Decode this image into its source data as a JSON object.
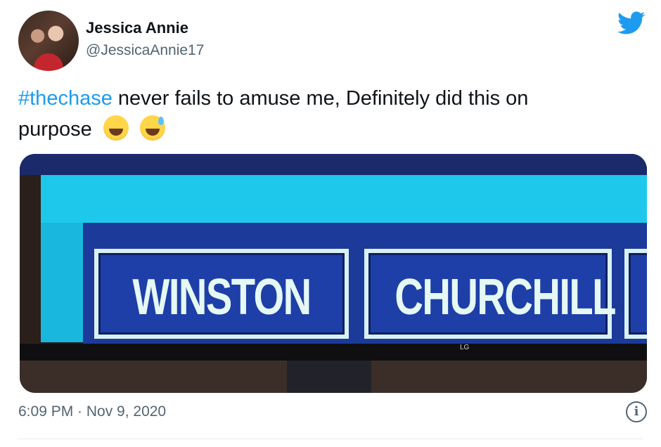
{
  "author": {
    "display_name": "Jessica Annie",
    "handle": "@JessicaAnnie17",
    "avatar_icon": "profile-photo"
  },
  "brand": {
    "icon": "twitter-bird-icon",
    "color": "#1d9bf0"
  },
  "tweet": {
    "hashtag": "#thechase",
    "text_line1": " never fails to amuse me, Definitely did this on",
    "text_line2": "purpose",
    "emojis": [
      "grinning-squinting-face",
      "grinning-face-with-sweat"
    ]
  },
  "media": {
    "panel_left": "WINSTON",
    "panel_right": "CHURCHILL",
    "tv_logo": "LG"
  },
  "footer": {
    "timestamp": "6:09 PM · Nov 9, 2020",
    "info_icon": "info-icon"
  }
}
